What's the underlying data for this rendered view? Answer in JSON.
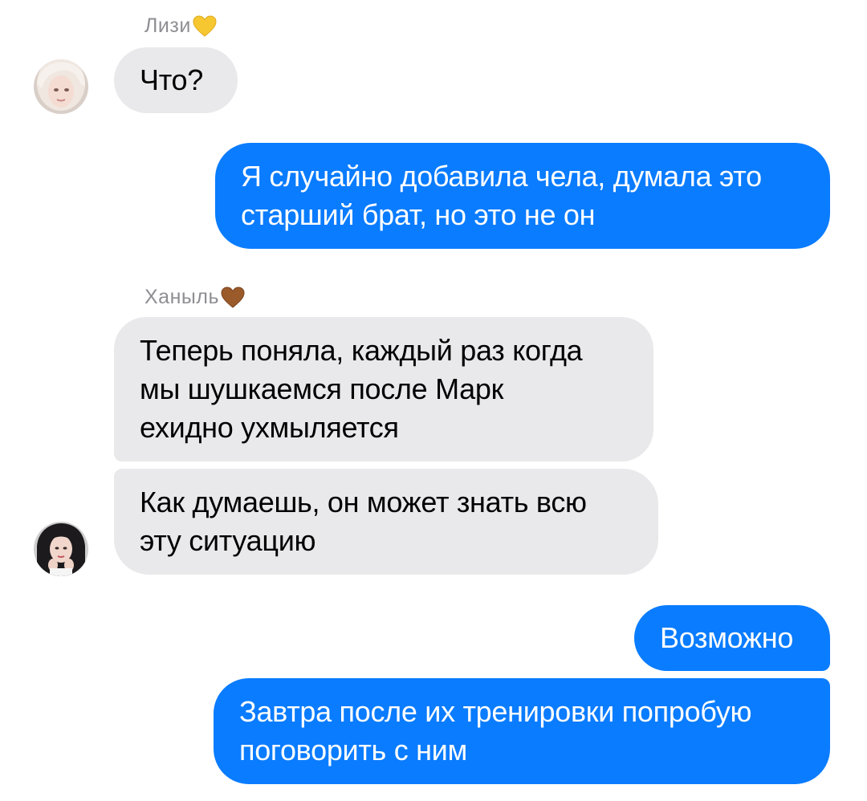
{
  "colors": {
    "incoming_bubble": "#e9e9eb",
    "outgoing_bubble": "#0a7cff",
    "sender_name": "#8e8e93",
    "heart_yellow": "#f7c731",
    "heart_brown": "#9a5a2a"
  },
  "messages": [
    {
      "sender": "Лизи",
      "sender_heart": "yellow-heart-icon",
      "direction": "incoming",
      "text": "Что?"
    },
    {
      "direction": "outgoing",
      "text": "Я случайно добавила чела, думала это\nстарший брат, но это не он"
    },
    {
      "sender": "Ханыль",
      "sender_heart": "brown-heart-icon",
      "direction": "incoming",
      "text": "Теперь поняла, каждый раз когда\nмы шушкаемся после Марк\nехидно ухмыляется"
    },
    {
      "direction": "incoming",
      "text": "Как думаешь, он может знать всю\nэту ситуацию"
    },
    {
      "direction": "outgoing",
      "text": "Возможно"
    },
    {
      "direction": "outgoing",
      "text": "Завтра после их тренировки попробую\nпоговорить с ним"
    }
  ]
}
